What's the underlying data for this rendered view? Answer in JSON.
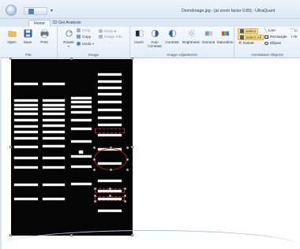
{
  "window": {
    "title": "DemoImage.jpg - [at zoom factor 0.85] - UltraQuant",
    "quick_access_dropdown": "▾"
  },
  "tabs": [
    {
      "label": "Home",
      "active": true
    },
    {
      "label": "1D Gel Analysis",
      "active": false
    }
  ],
  "ribbon": {
    "file": {
      "group_label": "File",
      "open": "Open",
      "save": "Save",
      "print": "Print"
    },
    "image": {
      "group_label": "Image",
      "rotate": "Rotate",
      "crop": "Crop",
      "copy": "Copy",
      "undo": "Undo",
      "redo": "Redo",
      "image_info": "Image Info"
    },
    "adjust": {
      "group_label": "Image Adjustment",
      "invert": "Invert",
      "auto_contrast": "Auto Contrast",
      "contrast": "Contrast",
      "brightness": "Brightness",
      "gamma": "Gamma",
      "saturation": "Saturation"
    },
    "annotation": {
      "group_label": "Annotation Objects",
      "select": "Select",
      "select_all": "Select All",
      "delete": "Delete",
      "line": "Line",
      "rectangle": "Rectangle",
      "ellipse": "Ellipse",
      "more_top": "Li",
      "more_mid": "Te"
    }
  },
  "colors": {
    "ribbon_bg": "#e3ecf7",
    "selection": "#b52020",
    "gel_bg": "#050505",
    "band": "#f2f2f2",
    "selected_button": "#ffd567"
  }
}
